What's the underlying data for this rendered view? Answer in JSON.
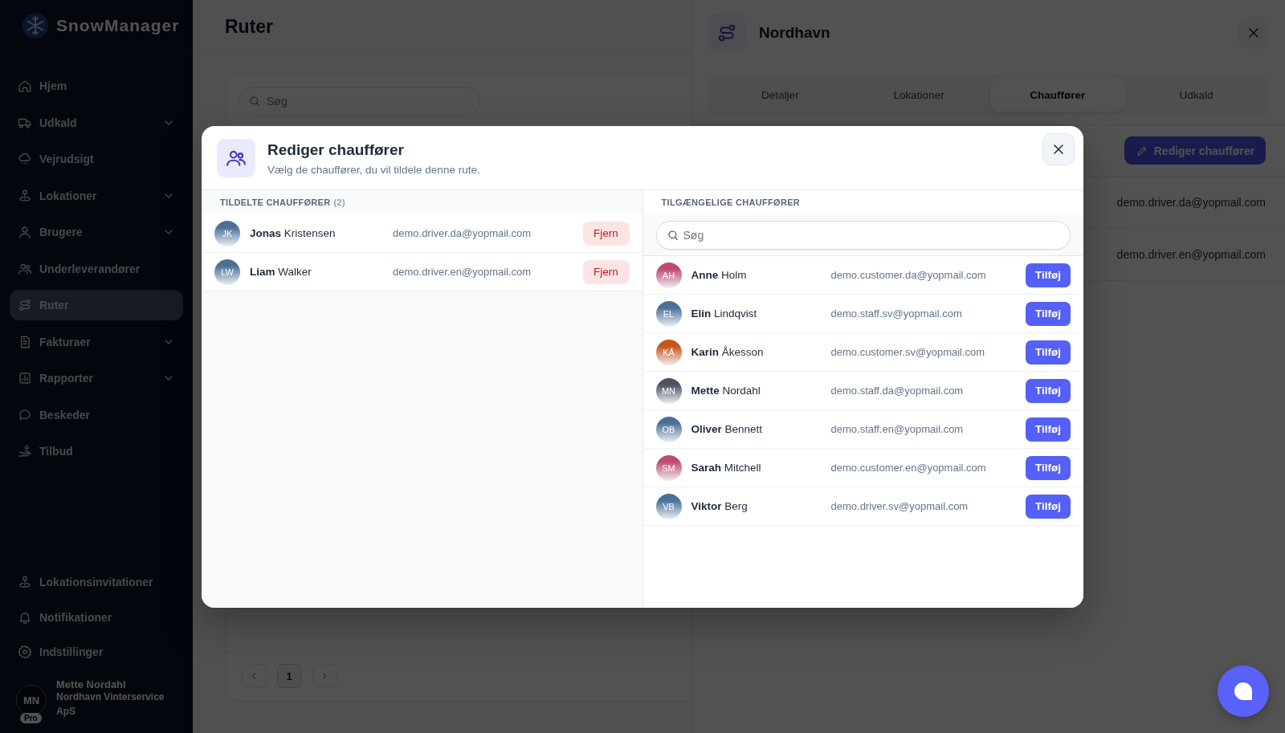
{
  "sidebar": {
    "brand": "SnowManager",
    "items": [
      {
        "label": "Hjem",
        "selected": false,
        "expandable": false
      },
      {
        "label": "Udkald",
        "selected": false,
        "expandable": true
      },
      {
        "label": "Vejrudsigt",
        "selected": false,
        "expandable": false
      },
      {
        "label": "Lokationer",
        "selected": false,
        "expandable": true
      },
      {
        "label": "Brugere",
        "selected": false,
        "expandable": true
      },
      {
        "label": "Underleverandører",
        "selected": false,
        "expandable": false
      },
      {
        "label": "Ruter",
        "selected": true,
        "expandable": false
      },
      {
        "label": "Fakturaer",
        "selected": false,
        "expandable": true
      },
      {
        "label": "Rapporter",
        "selected": false,
        "expandable": true
      },
      {
        "label": "Beskeder",
        "selected": false,
        "expandable": false
      },
      {
        "label": "Tilbud",
        "selected": false,
        "expandable": false
      }
    ],
    "footer_items": [
      {
        "label": "Lokationsinvitationer"
      },
      {
        "label": "Notifikationer"
      },
      {
        "label": "Indstillinger"
      }
    ],
    "user": {
      "initials": "MN",
      "badge": "Pro",
      "name": "Mette Nordahl",
      "company": "Nordhavn Vinterservice ApS"
    }
  },
  "page": {
    "title": "Ruter",
    "search": {
      "placeholder": "Søg"
    },
    "pagination": {
      "pages": [
        {
          "label": "1",
          "selected": true
        }
      ]
    }
  },
  "side_panel": {
    "title": "Nordhavn",
    "tabs": [
      {
        "label": "Detaljer",
        "selected": false
      },
      {
        "label": "Lokationer",
        "selected": false
      },
      {
        "label": "Chauffører",
        "selected": true
      },
      {
        "label": "Udkald",
        "selected": false
      }
    ],
    "edit_button": "Rediger chauffører",
    "emails": [
      "demo.driver.da@yopmail.com",
      "demo.driver.en@yopmail.com"
    ]
  },
  "modal": {
    "title": "Rediger chauffører",
    "subtitle": "Vælg de chauffører, du vil tildele denne rute.",
    "assigned": {
      "heading": "TILDELTE CHAUFFØRER",
      "count": "(2)",
      "drivers": [
        {
          "initials": "JK",
          "name": "**Jonas** Kristensen",
          "email": "demo.driver.da@yopmail.com",
          "color": "#4a7098",
          "action": "Fjern"
        },
        {
          "initials": "LW",
          "name": "**Liam** Walker",
          "email": "demo.driver.en@yopmail.com",
          "color": "#4a7098",
          "action": "Fjern"
        }
      ]
    },
    "available": {
      "heading": "TILGÆNGELIGE CHAUFFØRER",
      "search": {
        "placeholder": "Søg"
      },
      "drivers": [
        {
          "initials": "AH",
          "name": "**Anne** Holm",
          "email": "demo.customer.da@yopmail.com",
          "color": "#c04a74",
          "action": "Tilføj"
        },
        {
          "initials": "EL",
          "name": "**Elin** Lindqvist",
          "email": "demo.staff.sv@yopmail.com",
          "color": "#4a7098",
          "action": "Tilføj"
        },
        {
          "initials": "KÅ",
          "name": "**Karin** Åkesson",
          "email": "demo.customer.sv@yopmail.com",
          "color": "#c85418",
          "action": "Tilføj"
        },
        {
          "initials": "MN",
          "name": "**Mette** Nordahl",
          "email": "demo.staff.da@yopmail.com",
          "color": "#4b5263",
          "action": "Tilføj"
        },
        {
          "initials": "OB",
          "name": "**Oliver** Bennett",
          "email": "demo.staff.en@yopmail.com",
          "color": "#4a7098",
          "action": "Tilføj"
        },
        {
          "initials": "SM",
          "name": "**Sarah** Mitchell",
          "email": "demo.customer.en@yopmail.com",
          "color": "#c04a74",
          "action": "Tilføj"
        },
        {
          "initials": "VB",
          "name": "**Viktor** Berg",
          "email": "demo.driver.sv@yopmail.com",
          "color": "#4a7098",
          "action": "Tilføj"
        }
      ]
    }
  }
}
